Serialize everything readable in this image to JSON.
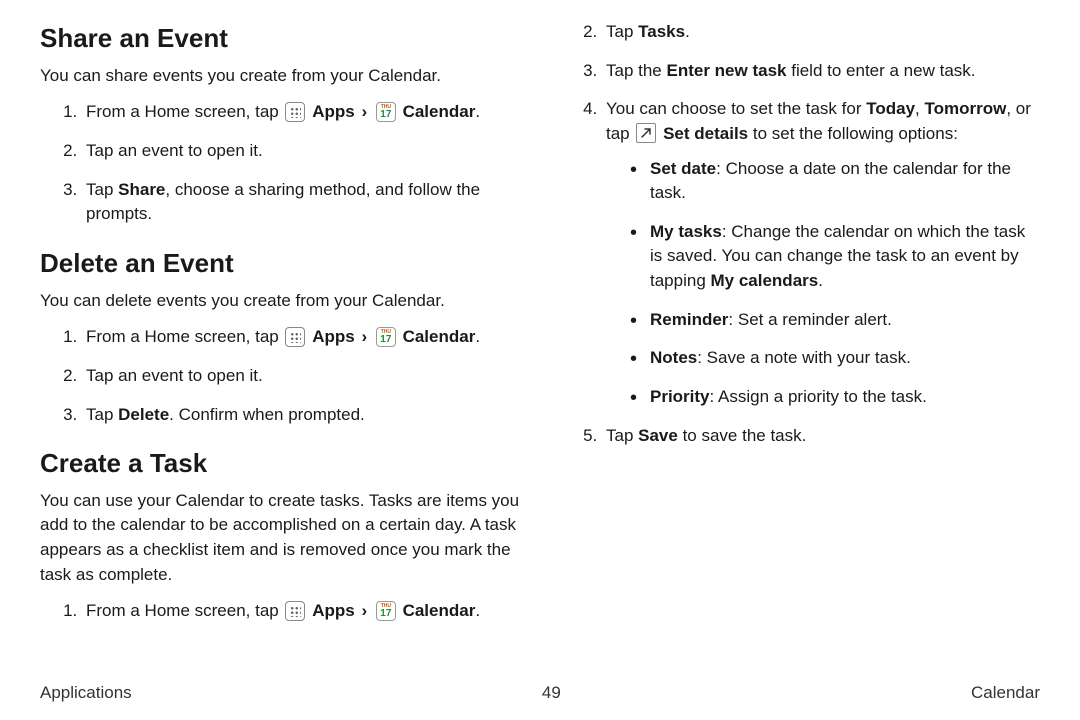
{
  "sections": {
    "share": {
      "heading": "Share an Event",
      "intro": "You can share events you create from your Calendar.",
      "steps": {
        "s1a": "From a Home screen, tap ",
        "s1b": "Apps",
        "s1c": "Calendar",
        "s2": "Tap an event to open it.",
        "s3a": "Tap ",
        "s3b": "Share",
        "s3c": ", choose a sharing method, and follow the prompts."
      }
    },
    "delete": {
      "heading": "Delete an Event",
      "intro": "You can delete events you create from your Calendar.",
      "steps": {
        "s1a": "From a Home screen, tap ",
        "s1b": "Apps",
        "s1c": "Calendar",
        "s2": "Tap an event to open it.",
        "s3a": "Tap ",
        "s3b": "Delete",
        "s3c": ". Confirm when prompted."
      }
    },
    "create": {
      "heading": "Create a Task",
      "intro": "You can use your Calendar to create tasks. Tasks are items you add to the calendar to be accomplished on a certain day. A task appears as a checklist item and is removed once you mark the task as complete.",
      "steps": {
        "s1a": "From a Home screen, tap ",
        "s1b": "Apps",
        "s1c": "Calendar",
        "s2a": "Tap ",
        "s2b": "Tasks",
        "s2c": ".",
        "s3a": "Tap the ",
        "s3b": "Enter new task",
        "s3c": " field to enter a new task.",
        "s4a": "You can choose to set the task for ",
        "s4b": "Today",
        "s4c": ", ",
        "s4d": "Tomorrow",
        "s4e": ", or tap ",
        "s4f": "Set details",
        "s4g": " to set the following options:",
        "bullets": {
          "b1a": "Set date",
          "b1b": ": Choose a date on the calendar for the task.",
          "b2a": "My tasks",
          "b2b": ": Change the calendar on which the task is saved. You can change the task to an event by tapping ",
          "b2c": "My calendars",
          "b2d": ".",
          "b3a": "Reminder",
          "b3b": ": Set a reminder alert.",
          "b4a": "Notes",
          "b4b": ": Save a note with your task.",
          "b5a": "Priority",
          "b5b": ": Assign a priority to the task."
        },
        "s5a": "Tap ",
        "s5b": "Save",
        "s5c": " to save the task."
      }
    }
  },
  "footer": {
    "left": "Applications",
    "center": "49",
    "right": "Calendar"
  },
  "icons": {
    "chevron": "›",
    "cal_day": "THU",
    "cal_num": "17"
  }
}
